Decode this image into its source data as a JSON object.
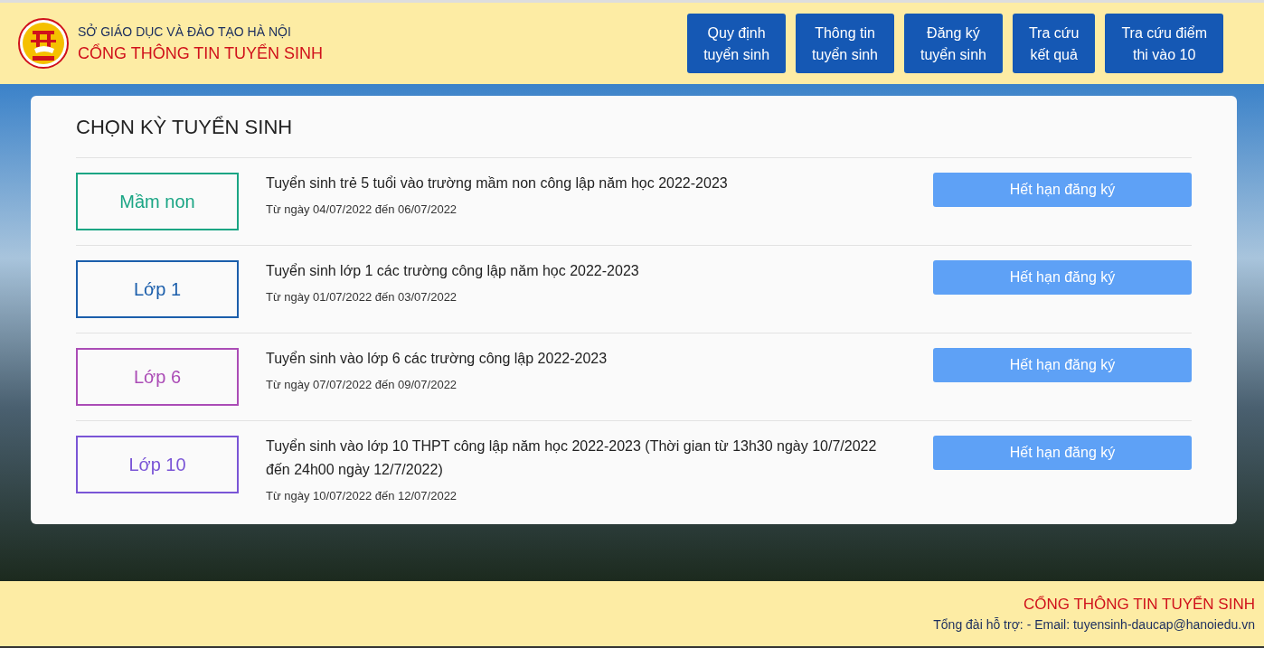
{
  "header": {
    "department": "SỞ GIÁO DỤC VÀ ĐÀO TẠO HÀ NỘI",
    "portal": "CỔNG THÔNG TIN TUYỂN SINH",
    "nav": [
      {
        "label": "Quy định\ntuyển sinh"
      },
      {
        "label": "Thông tin\ntuyển sinh"
      },
      {
        "label": "Đăng ký\ntuyển sinh"
      },
      {
        "label": "Tra cứu\nkết quả"
      },
      {
        "label": "Tra cứu điểm\nthi vào 10"
      }
    ]
  },
  "panel": {
    "title": "CHỌN KỲ TUYỂN SINH",
    "rounds": [
      {
        "level": "Mầm non",
        "color": "#1aa584",
        "name": "Tuyển sinh trẻ 5 tuổi vào trường mầm non công lập năm học 2022-2023",
        "dates": "Từ ngày 04/07/2022 đến 06/07/2022",
        "action": "Hết hạn đăng ký"
      },
      {
        "level": "Lớp 1",
        "color": "#1b5eab",
        "name": "Tuyển sinh lớp 1 các trường công lập năm học 2022-2023",
        "dates": "Từ ngày 01/07/2022 đến 03/07/2022",
        "action": "Hết hạn đăng ký"
      },
      {
        "level": "Lớp 6",
        "color": "#ab4cb6",
        "name": "Tuyển sinh vào lớp 6 các trường công lập 2022-2023",
        "dates": "Từ ngày 07/07/2022 đến 09/07/2022",
        "action": "Hết hạn đăng ký"
      },
      {
        "level": "Lớp 10",
        "color": "#7a55d6",
        "name": "Tuyển sinh vào lớp 10 THPT công lập năm học 2022-2023 (Thời gian từ 13h30 ngày 10/7/2022 đến 24h00 ngày 12/7/2022)",
        "dates": "Từ ngày 10/07/2022 đến 12/07/2022",
        "action": "Hết hạn đăng ký"
      }
    ]
  },
  "footer": {
    "portal": "CỔNG THÔNG TIN TUYỂN SINH",
    "contact": "Tổng đài hỗ trợ: - Email: tuyensinh-daucap@hanoiedu.vn"
  }
}
